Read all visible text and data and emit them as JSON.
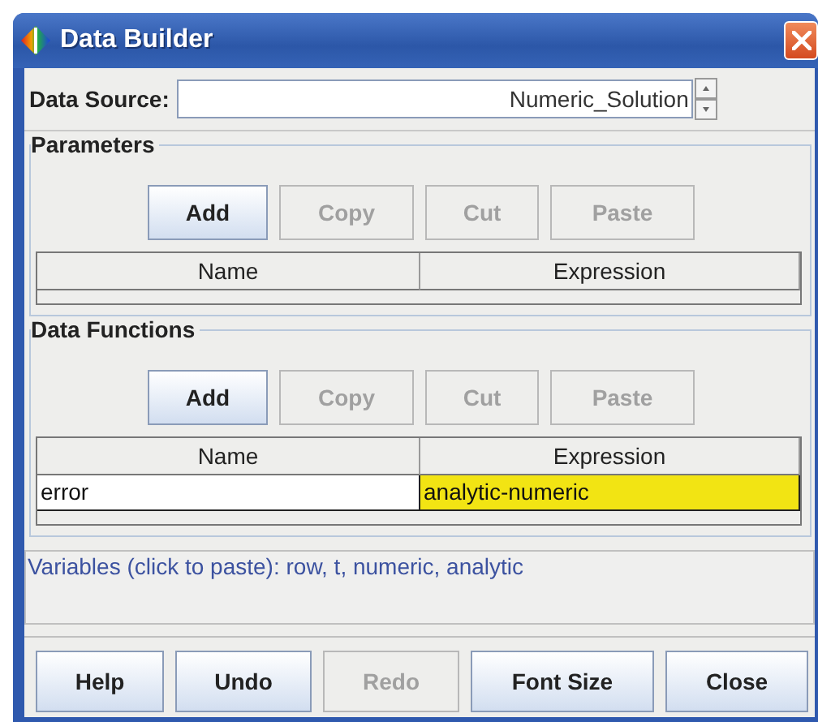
{
  "window": {
    "title": "Data Builder"
  },
  "data_source": {
    "label": "Data Source:",
    "value": "Numeric_Solution"
  },
  "groups": [
    {
      "title": "Parameters",
      "buttons": [
        {
          "label": "Add",
          "disabled": false
        },
        {
          "label": "Copy",
          "disabled": true
        },
        {
          "label": "Cut",
          "disabled": true
        },
        {
          "label": "Paste",
          "disabled": true
        }
      ],
      "columns": [
        "Name",
        "Expression"
      ]
    },
    {
      "title": "Data Functions",
      "buttons": [
        {
          "label": "Add",
          "disabled": false
        },
        {
          "label": "Copy",
          "disabled": true
        },
        {
          "label": "Cut",
          "disabled": true
        },
        {
          "label": "Paste",
          "disabled": true
        }
      ],
      "columns": [
        "Name",
        "Expression"
      ],
      "rows": [
        {
          "cells": [
            {
              "text": "error",
              "highlighted": false
            },
            {
              "text": "analytic-numeric",
              "highlighted": true
            }
          ]
        }
      ]
    }
  ],
  "variables_hint": "Variables (click to paste): row, t, numeric, analytic",
  "buttons": [
    {
      "label": "Help",
      "disabled": false
    },
    {
      "label": "Undo",
      "disabled": false
    },
    {
      "label": "Redo",
      "disabled": true
    },
    {
      "label": "Font Size",
      "disabled": false
    },
    {
      "label": "Close",
      "disabled": false
    }
  ]
}
